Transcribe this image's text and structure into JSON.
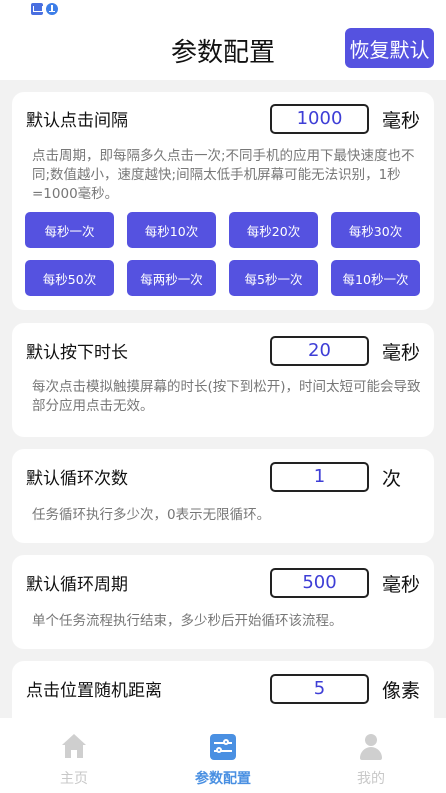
{
  "header": {
    "title": "参数配置",
    "restore_label": "恢复默认"
  },
  "cards": {
    "interval": {
      "label": "默认点击间隔",
      "value": "1000",
      "unit": "毫秒",
      "desc": "点击周期，即每隔多久点击一次;不同手机的应用下最快速度也不同;数值越小，速度越快;间隔太低手机屏幕可能无法识别，1秒=1000毫秒。",
      "presets": [
        "每秒一次",
        "每秒10次",
        "每秒20次",
        "每秒30次",
        "每秒50次",
        "每两秒一次",
        "每5秒一次",
        "每10秒一次"
      ]
    },
    "press": {
      "label": "默认按下时长",
      "value": "20",
      "unit": "毫秒",
      "desc": "每次点击模拟触摸屏幕的时长(按下到松开)，时间太短可能会导致部分应用点击无效。"
    },
    "loop_count": {
      "label": "默认循环次数",
      "value": "1",
      "unit": "次",
      "desc": "任务循环执行多少次，0表示无限循环。"
    },
    "loop_period": {
      "label": "默认循环周期",
      "value": "500",
      "unit": "毫秒",
      "desc": "单个任务流程执行结束，多少秒后开始循环该流程。"
    },
    "random": {
      "label": "点击位置随机距离",
      "value": "5",
      "unit": "像素"
    }
  },
  "tabs": [
    {
      "label": "主页",
      "icon": "home-icon",
      "active": false
    },
    {
      "label": "参数配置",
      "icon": "settings-sliders-icon",
      "active": true
    },
    {
      "label": "我的",
      "icon": "user-icon",
      "active": false
    }
  ],
  "colors": {
    "accent": "#5552e0",
    "tab_active": "#4a90e2",
    "value_text": "#3e3ed6"
  }
}
